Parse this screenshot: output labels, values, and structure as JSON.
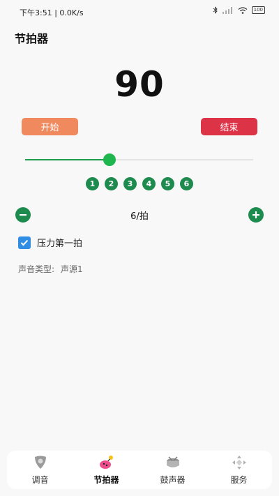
{
  "status_bar": {
    "time": "下午3:51 | 0.0K/s",
    "battery": "100"
  },
  "header": {
    "title": "节拍器"
  },
  "metronome": {
    "bpm": "90",
    "start_label": "开始",
    "stop_label": "结束",
    "tempo_fraction": 0.37,
    "beats": [
      "1",
      "2",
      "3",
      "4",
      "5",
      "6"
    ],
    "beats_label": "6/拍",
    "accent_checkbox": {
      "label": "压力第一拍",
      "checked": true
    },
    "sound_type": {
      "label": "声音类型:",
      "value": "声源1"
    }
  },
  "tabs": [
    {
      "label": "调音",
      "icon": "guitar-pick-icon",
      "active": false
    },
    {
      "label": "节拍器",
      "icon": "metronome-icon",
      "active": true
    },
    {
      "label": "鼓声器",
      "icon": "drum-icon",
      "active": false
    },
    {
      "label": "服务",
      "icon": "service-icon",
      "active": false
    }
  ],
  "colors": {
    "accent_green": "#1d8a4e",
    "start": "#f0895e",
    "stop": "#dd3347",
    "checkbox": "#2f8de4"
  }
}
